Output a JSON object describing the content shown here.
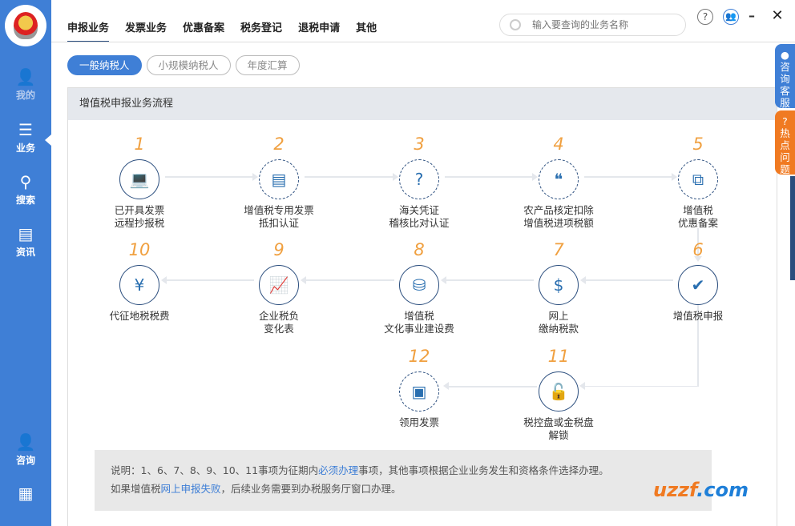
{
  "sidebar": {
    "items": [
      {
        "label": "我的",
        "icon": "broadcast-user-icon"
      },
      {
        "label": "业务",
        "icon": "list-icon"
      },
      {
        "label": "搜索",
        "icon": "search-icon"
      },
      {
        "label": "资讯",
        "icon": "news-icon"
      },
      {
        "label": "咨询",
        "icon": "chat-user-icon"
      },
      {
        "icon": "calendar-icon"
      }
    ]
  },
  "tabs": [
    "申报业务",
    "发票业务",
    "优惠备案",
    "税务登记",
    "退税申请",
    "其他"
  ],
  "search": {
    "placeholder": "输入要查询的业务名称"
  },
  "window": {
    "help": "?",
    "minimize": "–",
    "close": "✕"
  },
  "pills": [
    "一般纳税人",
    "小规模纳税人",
    "年度汇算"
  ],
  "panel": {
    "title": "增值税申报业务流程"
  },
  "steps": [
    {
      "num": "1",
      "l1": "已开具发票",
      "l2": "远程抄报税",
      "icon": "laptop-icon",
      "required": true
    },
    {
      "num": "2",
      "l1": "增值税专用发票",
      "l2": "抵扣认证",
      "icon": "document-icon",
      "required": false
    },
    {
      "num": "3",
      "l1": "海关凭证",
      "l2": "稽核比对认证",
      "icon": "question-document-icon",
      "required": false
    },
    {
      "num": "4",
      "l1": "农产品核定扣除",
      "l2": "增值税进项税额",
      "icon": "chat-bubbles-icon",
      "required": false
    },
    {
      "num": "5",
      "l1": "增值税",
      "l2": "优惠备案",
      "icon": "linked-documents-icon",
      "required": false
    },
    {
      "num": "6",
      "l1": "增值税申报",
      "l2": "",
      "icon": "checkmark-icon",
      "required": true
    },
    {
      "num": "7",
      "l1": "网上",
      "l2": "缴纳税款",
      "icon": "dollar-bars-icon",
      "required": true
    },
    {
      "num": "8",
      "l1": "增值税",
      "l2": "文化事业建设费",
      "icon": "coins-icon",
      "required": true
    },
    {
      "num": "9",
      "l1": "企业税负",
      "l2": "变化表",
      "icon": "growth-chart-icon",
      "required": true
    },
    {
      "num": "10",
      "l1": "代征地税税费",
      "l2": "",
      "icon": "currency-coins-icon",
      "required": true
    },
    {
      "num": "11",
      "l1": "税控盘或金税盘",
      "l2": "解锁",
      "icon": "unlock-icon",
      "required": true
    },
    {
      "num": "12",
      "l1": "领用发票",
      "l2": "",
      "icon": "monitor-icon",
      "required": false
    }
  ],
  "note": {
    "p1a": "说明：1、6、7、8、9、10、11事项为征期内",
    "p1link": "必须办理",
    "p1b": "事项，其他事项根据企业业务发生和资格条件选择办理。",
    "p2a": "如果增值税",
    "p2link": "网上申报失败",
    "p2b": "，后续业务需要到办税服务厅窗口办理。"
  },
  "side_tabs": [
    "咨询客服",
    "热点问题"
  ],
  "watermark": {
    "a": "uzzf",
    "b": ".com"
  }
}
